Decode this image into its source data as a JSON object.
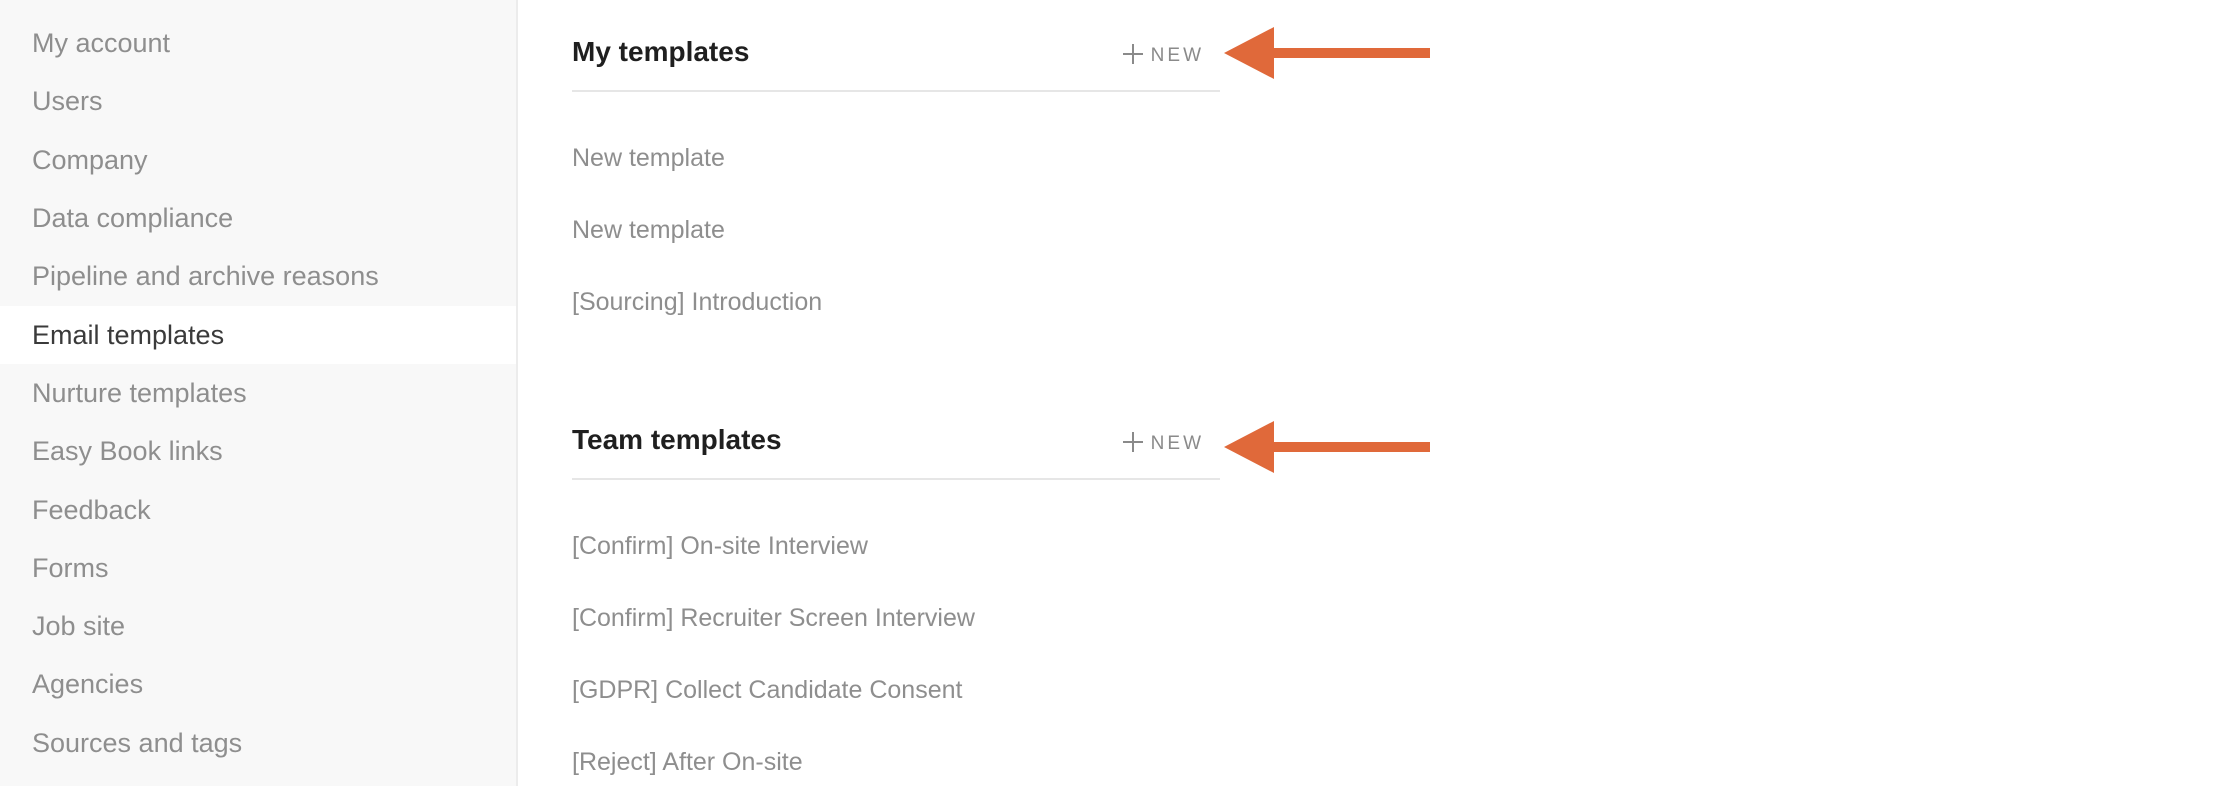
{
  "sidebar": {
    "items": [
      {
        "label": "My account",
        "active": false
      },
      {
        "label": "Users",
        "active": false
      },
      {
        "label": "Company",
        "active": false
      },
      {
        "label": "Data compliance",
        "active": false
      },
      {
        "label": "Pipeline and archive reasons",
        "active": false
      },
      {
        "label": "Email templates",
        "active": true
      },
      {
        "label": "Nurture templates",
        "active": false
      },
      {
        "label": "Easy Book links",
        "active": false
      },
      {
        "label": "Feedback",
        "active": false
      },
      {
        "label": "Forms",
        "active": false
      },
      {
        "label": "Job site",
        "active": false
      },
      {
        "label": "Agencies",
        "active": false
      },
      {
        "label": "Sources and tags",
        "active": false
      }
    ]
  },
  "my_templates": {
    "title": "My templates",
    "new_label": "NEW",
    "items": [
      "New template",
      "New template",
      "[Sourcing] Introduction"
    ]
  },
  "team_templates": {
    "title": "Team templates",
    "new_label": "NEW",
    "items": [
      "[Confirm] On-site Interview",
      "[Confirm] Recruiter Screen Interview",
      "[GDPR] Collect Candidate Consent",
      "[Reject] After On-site"
    ]
  },
  "colors": {
    "accent_arrow": "#e0693a",
    "sidebar_bg": "#f8f8f8",
    "text_muted": "#8e8e8e"
  }
}
